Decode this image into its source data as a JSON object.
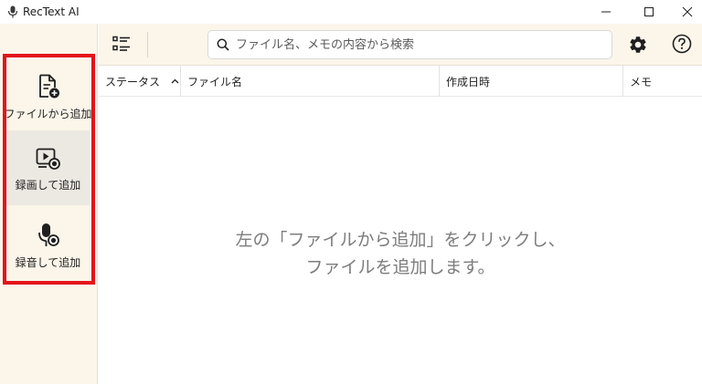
{
  "window": {
    "title": "RecText AI",
    "controls": [
      "minimize",
      "maximize",
      "close"
    ]
  },
  "sidebar": {
    "items": [
      {
        "label": "ファイルから追加",
        "icon": "file-add-icon"
      },
      {
        "label": "録画して追加",
        "icon": "video-record-icon"
      },
      {
        "label": "録音して追加",
        "icon": "mic-record-icon"
      }
    ],
    "highlight_color": "#e3141b"
  },
  "toolbar": {
    "search": {
      "placeholder": "ファイル名、メモの内容から検索",
      "value": ""
    }
  },
  "table": {
    "columns": [
      "ステータス",
      "ファイル名",
      "作成日時",
      "メモ"
    ],
    "rows": []
  },
  "empty_state": {
    "line1": "左の「ファイルから追加」をクリックし、",
    "line2": "ファイルを追加します。"
  },
  "colors": {
    "sidebar_bg": "#fbf5ea",
    "active_item_bg": "#ece8e2",
    "empty_text": "#7d7d7d"
  }
}
